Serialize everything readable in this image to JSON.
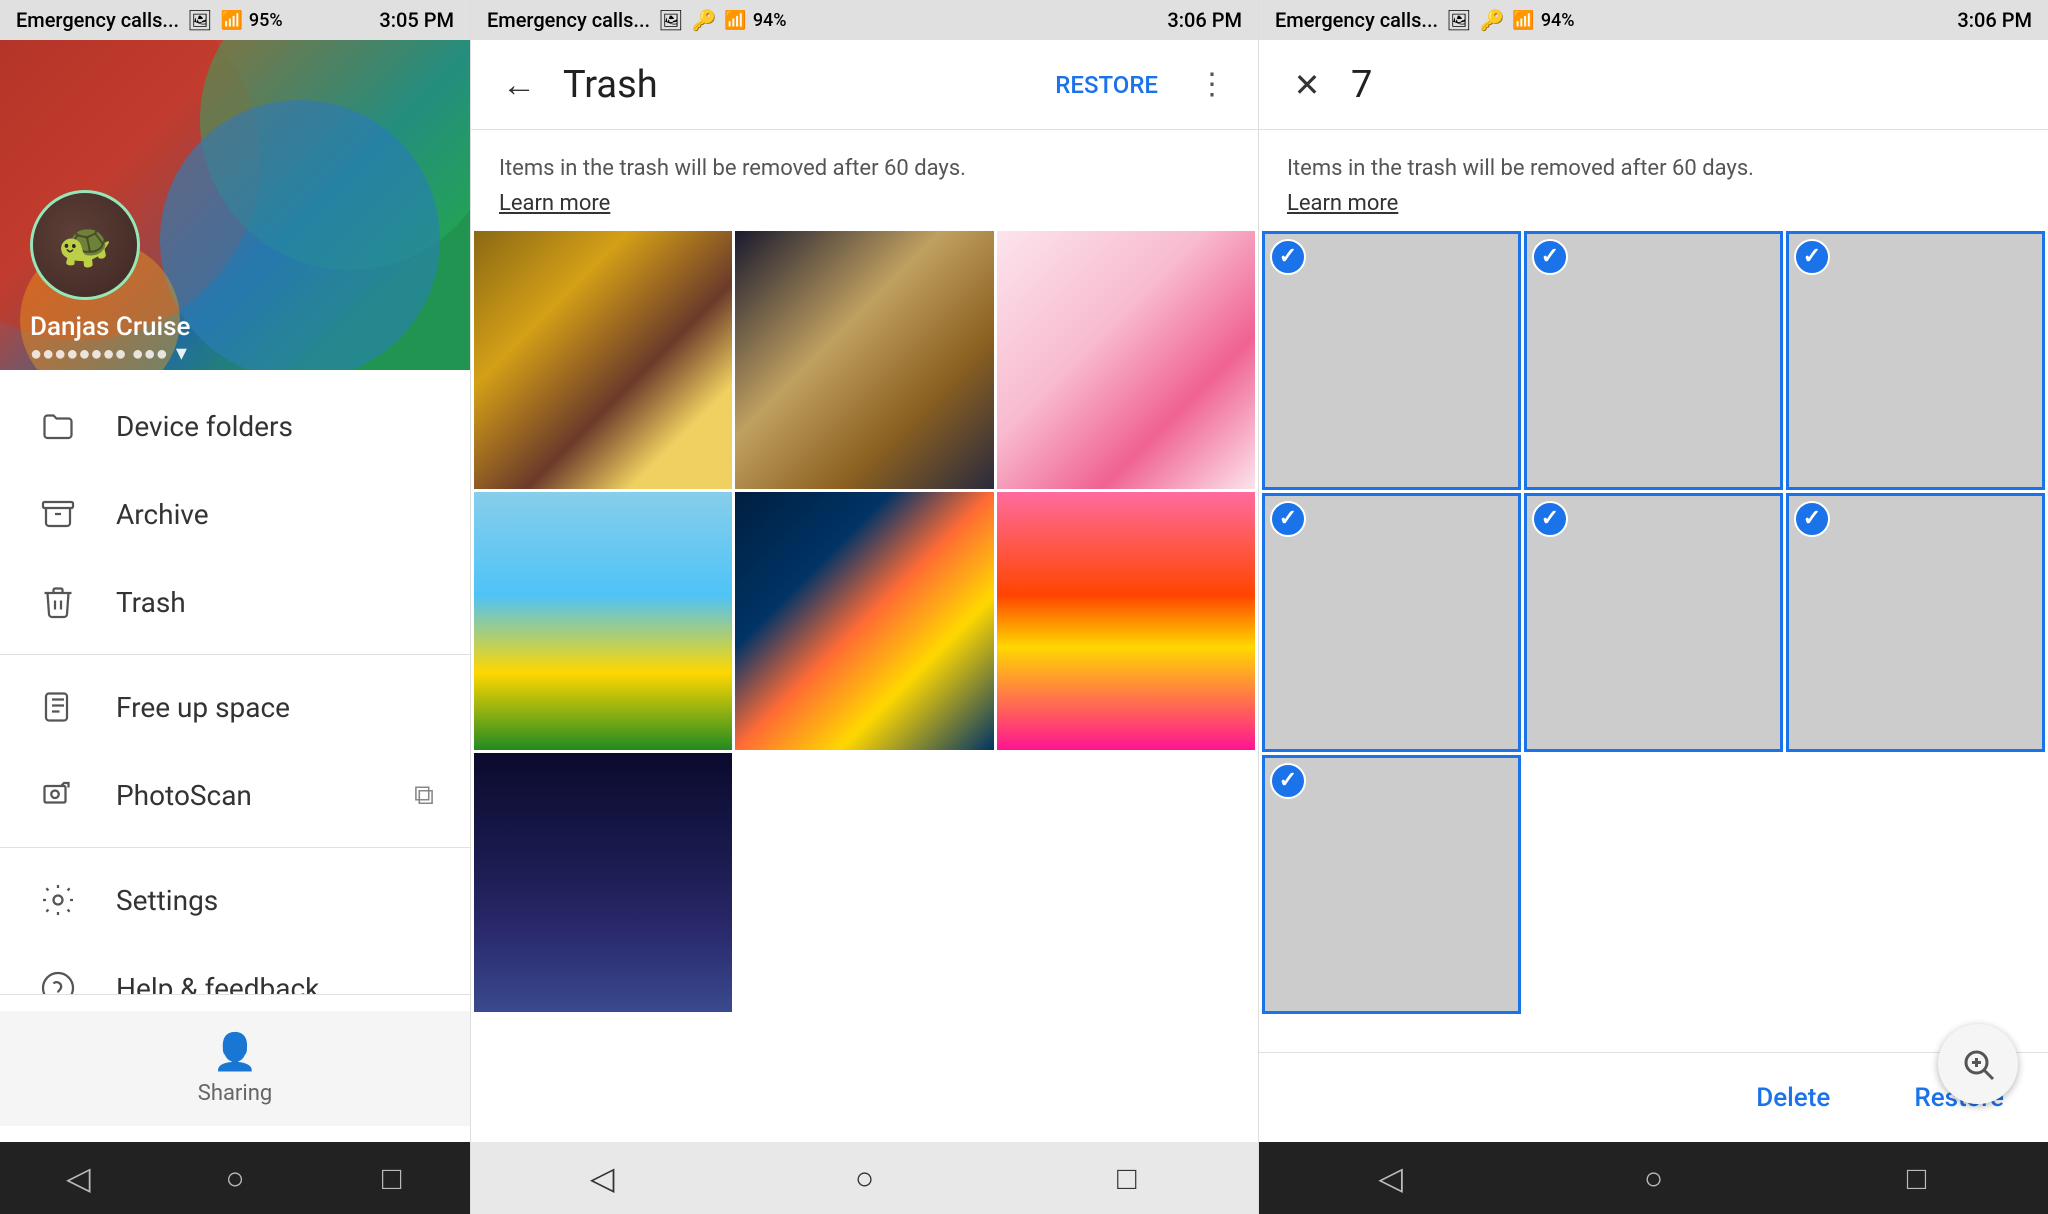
{
  "panels": {
    "panel1": {
      "statusBar": {
        "leftText": "Emergency calls...",
        "time": "3:05 PM",
        "battery": "95%"
      },
      "user": {
        "name": "Danjas Cruise",
        "emailMasked": "●●●●●●●● ●●●"
      },
      "navItems": [
        {
          "id": "device-folders",
          "label": "Device folders",
          "icon": "folder"
        },
        {
          "id": "archive",
          "label": "Archive",
          "icon": "archive"
        },
        {
          "id": "trash",
          "label": "Trash",
          "icon": "trash"
        },
        {
          "id": "free-up-space",
          "label": "Free up space",
          "icon": "note"
        },
        {
          "id": "photoscan",
          "label": "PhotoScan",
          "icon": "camera",
          "external": true
        },
        {
          "id": "settings",
          "label": "Settings",
          "icon": "gear"
        },
        {
          "id": "help",
          "label": "Help & feedback",
          "icon": "help"
        }
      ],
      "sharingLabel": "Sharing"
    },
    "panel2": {
      "statusBar": {
        "leftText": "Emergency calls...",
        "time": "3:06 PM",
        "battery": "94%"
      },
      "toolbar": {
        "backIcon": "←",
        "title": "Trash",
        "restoreLabel": "RESTORE",
        "moreIcon": "⋮"
      },
      "infoText": "Items in the trash will be removed after 60 days.",
      "learnMore": "Learn more",
      "photos": [
        {
          "id": "p1",
          "colorClass": "photo-autumn"
        },
        {
          "id": "p2",
          "colorClass": "photo-crystal"
        },
        {
          "id": "p3",
          "colorClass": "photo-floral"
        },
        {
          "id": "p4",
          "colorClass": "photo-sunflower"
        },
        {
          "id": "p5",
          "colorClass": "photo-fish"
        },
        {
          "id": "p6",
          "colorClass": "photo-sunset"
        },
        {
          "id": "p7",
          "colorClass": "photo-stars"
        }
      ]
    },
    "panel3": {
      "statusBar": {
        "leftText": "Emergency calls...",
        "time": "3:06 PM",
        "battery": "94%"
      },
      "toolbar": {
        "closeIcon": "✕",
        "count": "7"
      },
      "infoText": "Items in the trash will be removed after 60 days.",
      "learnMore": "Learn more",
      "photos": [
        {
          "id": "sp1",
          "colorClass": "photo-autumn",
          "selected": true
        },
        {
          "id": "sp2",
          "colorClass": "photo-crystal",
          "selected": true
        },
        {
          "id": "sp3",
          "colorClass": "photo-floral",
          "selected": true
        },
        {
          "id": "sp4",
          "colorClass": "photo-sunflower",
          "selected": true
        },
        {
          "id": "sp5",
          "colorClass": "photo-fish",
          "selected": true
        },
        {
          "id": "sp6",
          "colorClass": "photo-sunset",
          "selected": true
        },
        {
          "id": "sp7",
          "colorClass": "photo-stars",
          "selected": true
        }
      ],
      "actions": {
        "delete": "Delete",
        "restore": "Restore"
      }
    }
  }
}
